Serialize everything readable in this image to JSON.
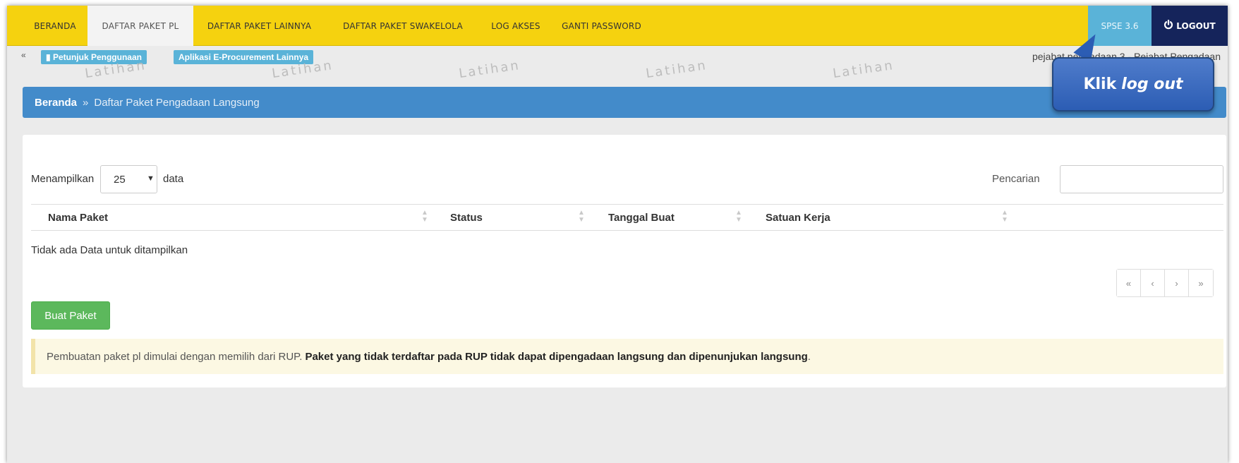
{
  "nav": {
    "items": [
      {
        "label": "BERANDA",
        "active": false
      },
      {
        "label": "DAFTAR PAKET PL",
        "active": true
      },
      {
        "label": "DAFTAR PAKET LAINNYA",
        "active": false
      },
      {
        "label": "DAFTAR PAKET SWAKELOLA",
        "active": false
      },
      {
        "label": "LOG AKSES",
        "active": false
      },
      {
        "label": "GANTI PASSWORD",
        "active": false
      }
    ],
    "version": "SPSE 3.6",
    "logout": "LOGOUT",
    "colors": {
      "bar": "#f5d20f",
      "version_bg": "#5ab3d8",
      "logout_bg": "#15245b"
    }
  },
  "subbar": {
    "petunjuk": "Petunjuk Penggunaan",
    "aplikasi": "Aplikasi E-Procurement Lainnya",
    "user": "pejabat pengadaan 3 - Pejabat Pengadaan"
  },
  "watermark": "Latihan",
  "breadcrumb": {
    "home": "Beranda",
    "separator": "»",
    "current": "Daftar Paket Pengadaan Langsung"
  },
  "table_controls": {
    "show_label": "Menampilkan",
    "page_size": "25",
    "data_label": "data",
    "search_label": "Pencarian",
    "search_value": ""
  },
  "table": {
    "columns": [
      "Nama Paket",
      "Status",
      "Tanggal Buat",
      "Satuan Kerja"
    ],
    "empty_message": "Tidak ada Data untuk ditampilkan"
  },
  "pager": {
    "first": "«",
    "prev": "‹",
    "next": "›",
    "last": "»"
  },
  "buat_paket": "Buat Paket",
  "alert": {
    "normal": "Pembuatan paket pl dimulai dengan memilih dari RUP.",
    "bold": "Paket yang tidak terdaftar pada RUP tidak dapat dipengadaan langsung dan dipenunjukan langsung",
    "end": "."
  },
  "callout": {
    "prefix": "Klik",
    "emph": "log out"
  }
}
